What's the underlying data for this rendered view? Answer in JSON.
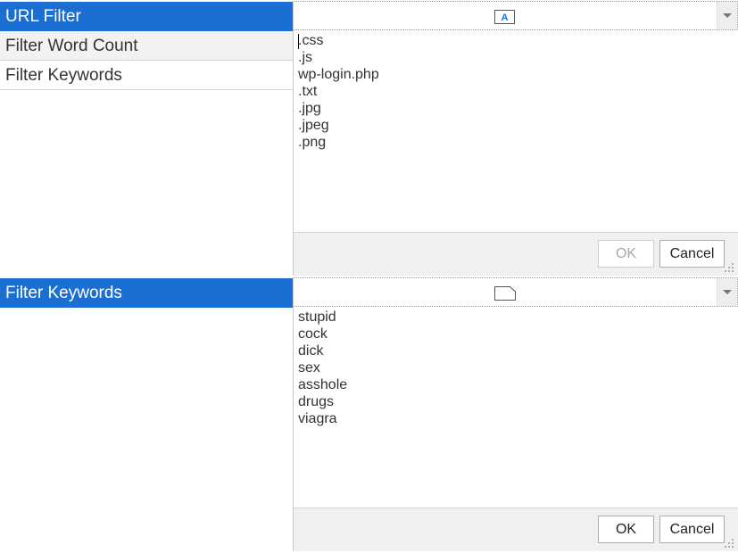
{
  "rows": {
    "url_filter": "URL Filter",
    "filter_word_count": "Filter Word Count",
    "filter_keywords": "Filter Keywords",
    "filter_keywords_selected": "Filter Keywords"
  },
  "editor_top": {
    "combo_icon": "text-format-icon",
    "items": [
      ".css",
      ".js",
      "wp-login.php",
      ".txt",
      ".jpg",
      ".jpeg",
      ".png"
    ],
    "ok_label": "OK",
    "cancel_label": "Cancel"
  },
  "editor_bottom": {
    "combo_icon": "blank-document-icon",
    "items": [
      "stupid",
      "cock",
      "dick",
      "sex",
      "asshole",
      "drugs",
      "viagra"
    ],
    "ok_label": "OK",
    "cancel_label": "Cancel"
  },
  "colors": {
    "selection": "#1b6fd2",
    "row_alt": "#f2f2f2",
    "footer": "#f0f0f0"
  }
}
